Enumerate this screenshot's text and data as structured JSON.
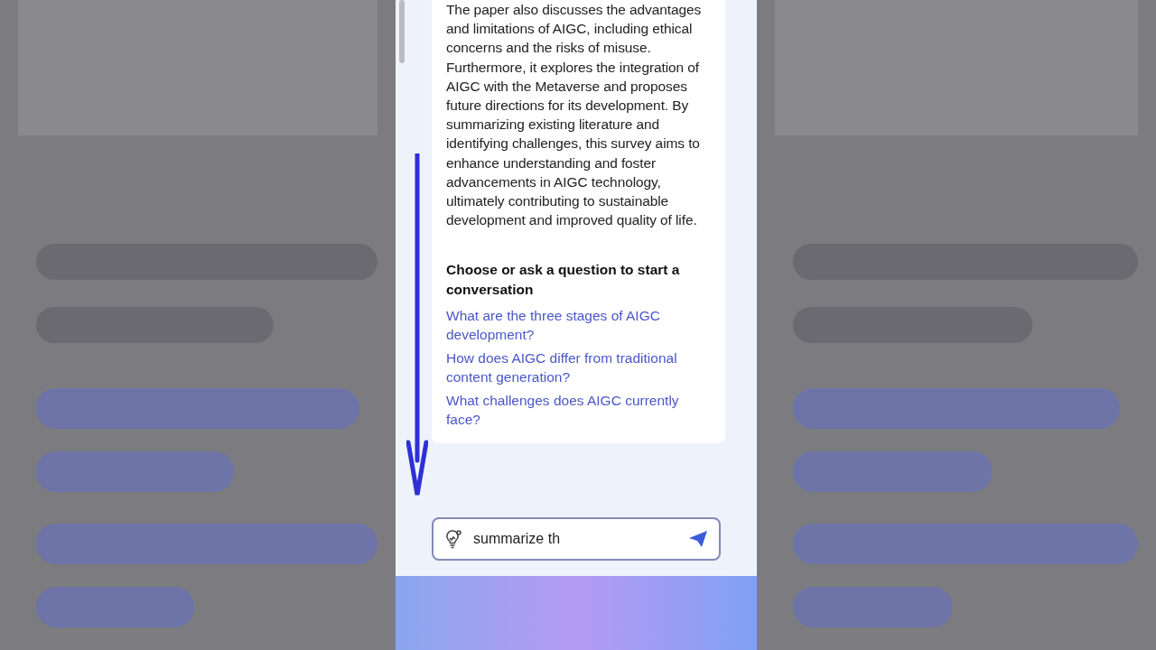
{
  "summary": "The paper also discusses the advantages and limitations of AIGC, including ethical concerns and the risks of misuse. Furthermore, it explores the integration of AIGC with the Metaverse and proposes future directions for its development. By summarizing existing literature and identifying challenges, this survey aims to enhance understanding and foster advancements in AIGC technology, ultimately contributing to sustainable development and improved quality of life.",
  "prompt_heading": "Choose or ask a question to start a conversation",
  "questions": [
    "What are the three stages of AIGC development?",
    "How does AIGC differ from traditional content generation?",
    "What challenges does AIGC currently face?"
  ],
  "input": {
    "value": "summarize th"
  }
}
